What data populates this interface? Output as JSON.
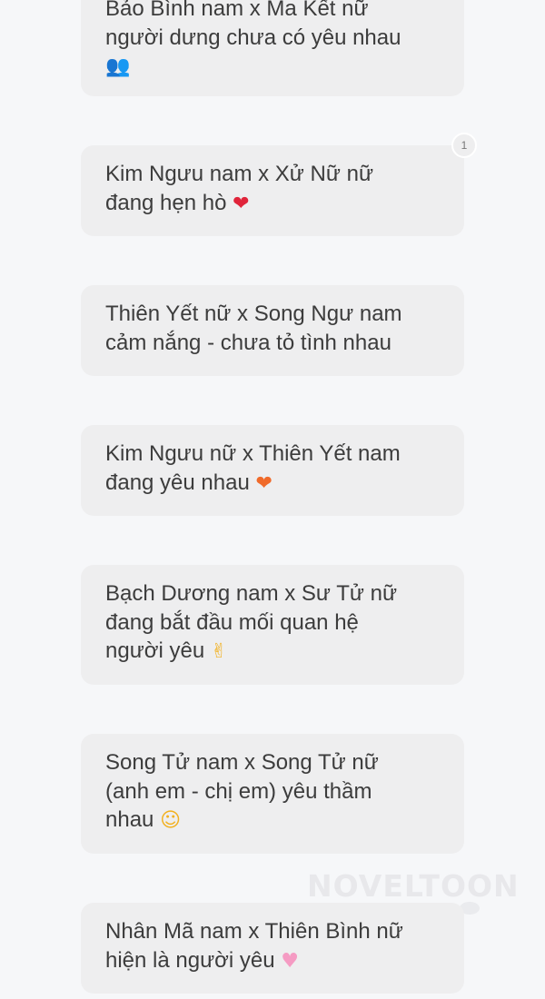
{
  "messages": [
    {
      "line1": "Bảo Bình nam x Ma Kết nữ",
      "line2": "người dưng chưa có yêu nhau",
      "line3": "",
      "emoji": "👥",
      "emoji_name": "people-icon"
    },
    {
      "line1": "Kim Ngưu nam x Xử Nữ nữ",
      "line2": "đang hẹn hò",
      "line3": "",
      "emoji": "❤",
      "emoji_name": "red-heart-icon"
    },
    {
      "line1": "Thiên Yết nữ x Song Ngư nam",
      "line2": "cảm nắng - chưa tỏ tình nhau",
      "line3": "",
      "emoji": "",
      "emoji_name": ""
    },
    {
      "line1": "Kim Ngưu nữ x Thiên Yết nam",
      "line2": "đang yêu nhau",
      "line3": "",
      "emoji": "❤",
      "emoji_name": "heart-on-fire-icon"
    },
    {
      "line1": "Bạch Dương nam x Sư Tử nữ",
      "line2": "đang bắt đầu mối quan hệ",
      "line3": "người yêu",
      "emoji": "✌",
      "emoji_name": "finger-heart-icon"
    },
    {
      "line1": "Song Tử nam x Song Tử nữ",
      "line2": "(anh em - chị em) yêu thầm",
      "line3": "nhau",
      "emoji": "☺",
      "emoji_name": "kissing-face-icon"
    },
    {
      "line1": "Nhân Mã nam x Thiên Bình nữ",
      "line2": "hiện là người yêu",
      "line3": "",
      "emoji": "♥",
      "emoji_name": "pink-heart-icon"
    }
  ],
  "badge_count": "1",
  "watermark": "NOVELTOON"
}
